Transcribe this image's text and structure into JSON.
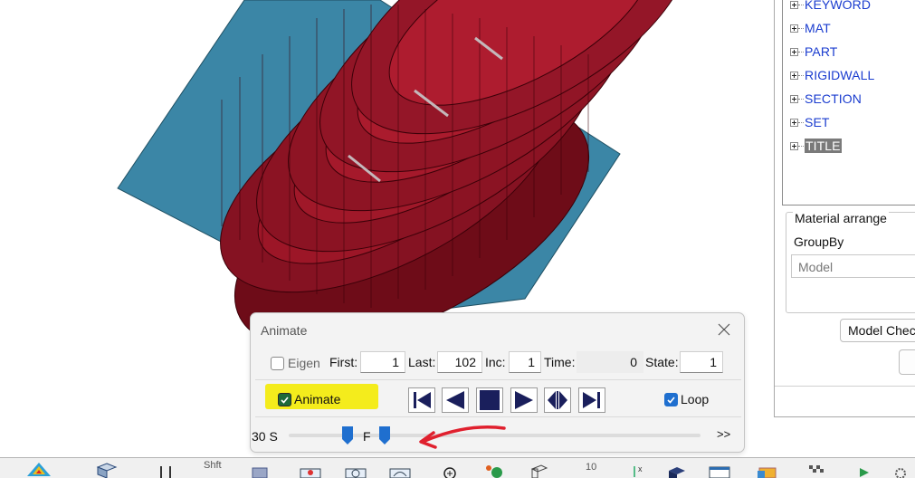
{
  "tree": {
    "items": [
      {
        "label": "KEYWORD",
        "selected": false
      },
      {
        "label": "MAT",
        "selected": false
      },
      {
        "label": "PART",
        "selected": false
      },
      {
        "label": "RIGIDWALL",
        "selected": false
      },
      {
        "label": "SECTION",
        "selected": false
      },
      {
        "label": "SET",
        "selected": false
      },
      {
        "label": "TITLE",
        "selected": true
      }
    ]
  },
  "material": {
    "group_title": "Material arrange",
    "groupby_label": "GroupBy",
    "groupby_value": "Model"
  },
  "buttons": {
    "model_check": "Model Chec"
  },
  "animate": {
    "title": "Animate",
    "eigen_label": "Eigen",
    "eigen_checked": false,
    "first_label": "First:",
    "first_value": "1",
    "last_label": "Last:",
    "last_value": "102",
    "inc_label": "Inc:",
    "inc_value": "1",
    "time_label": "Time:",
    "time_value": "0",
    "state_label": "State:",
    "state_value": "1",
    "animate_label": "Animate",
    "animate_checked": true,
    "loop_label": "Loop",
    "loop_checked": true,
    "speed_label_slow": "30 S",
    "speed_label_fast": "F",
    "speed_more": ">>",
    "controls": [
      "first-frame-icon",
      "step-back-icon",
      "stop-icon",
      "play-icon",
      "bounce-icon",
      "last-frame-icon"
    ]
  },
  "toolbar": {
    "shift_label": "Shft",
    "number_label": "10"
  },
  "colors": {
    "model_red": "#8b1020",
    "wall_blue": "#3a87a8",
    "highlight_yellow": "#f4ec1c",
    "annotation_red": "#e0202e",
    "tree_link": "#1a3ccf",
    "accent_blue": "#1f6fcf"
  }
}
